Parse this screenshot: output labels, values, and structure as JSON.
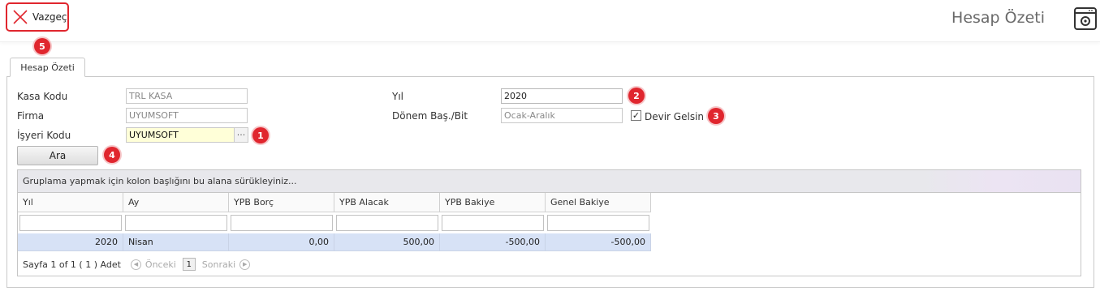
{
  "toolbar": {
    "cancel_label": "Vazgeç",
    "title": "Hesap Özeti"
  },
  "tab": {
    "label": "Hesap Özeti"
  },
  "form": {
    "kasa_kodu": {
      "label": "Kasa Kodu",
      "value": "TRL KASA"
    },
    "firma": {
      "label": "Firma",
      "value": "UYUMSOFT"
    },
    "isyeri_kodu": {
      "label": "İşyeri Kodu",
      "value": "UYUMSOFT",
      "button": "···"
    },
    "yil": {
      "label": "Yıl",
      "value": "2020"
    },
    "donem": {
      "label": "Dönem Baş./Bit",
      "value": "Ocak-Aralık"
    },
    "devir": {
      "label": "Devir Gelsin",
      "checked": true,
      "mark": "✓"
    },
    "search_label": "Ara"
  },
  "badges": [
    "1",
    "2",
    "3",
    "4",
    "5"
  ],
  "grid": {
    "group_hint": "Gruplama yapmak için kolon başlığını bu alana sürükleyiniz...",
    "columns": [
      "Yıl",
      "Ay",
      "YPB Borç",
      "YPB Alacak",
      "YPB Bakiye",
      "Genel Bakiye"
    ],
    "rows": [
      [
        "2020",
        "Nisan",
        "0,00",
        "500,00",
        "-500,00",
        "-500,00"
      ]
    ],
    "pager": {
      "summary": "Sayfa 1 of 1 ( 1 ) Adet",
      "prev": "Önceki",
      "page": "1",
      "next": "Sonraki"
    }
  },
  "colors": {
    "accent_red": "#e0262e",
    "row_selected": "#d7e2f6"
  }
}
